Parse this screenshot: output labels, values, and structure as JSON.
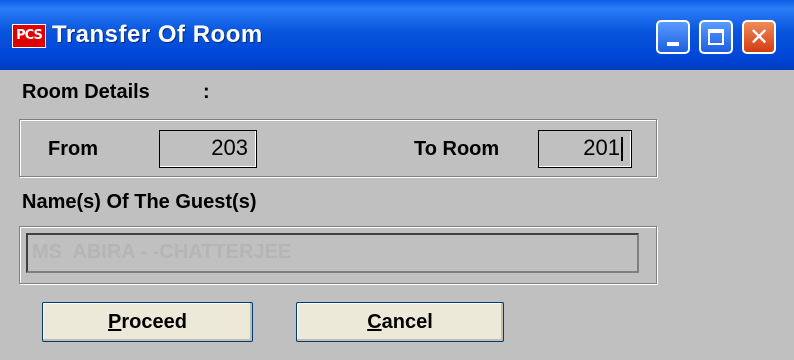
{
  "window": {
    "title": "Transfer Of Room",
    "app_icon_text": "PCS",
    "titlebar_color": "#0054e3",
    "close_color": "#e14d1b"
  },
  "room_details": {
    "label": "Room Details",
    "colon": ":",
    "from_label": "From",
    "from_value": "203",
    "to_label": "To Room",
    "to_value": "201"
  },
  "guest": {
    "label": "Name(s) Of The Guest(s)",
    "name_value": "MS  ABIRA - -CHATTERJEE"
  },
  "buttons": {
    "proceed_mnemonic": "P",
    "proceed_rest": "roceed",
    "cancel_mnemonic": "C",
    "cancel_rest": "ancel"
  }
}
